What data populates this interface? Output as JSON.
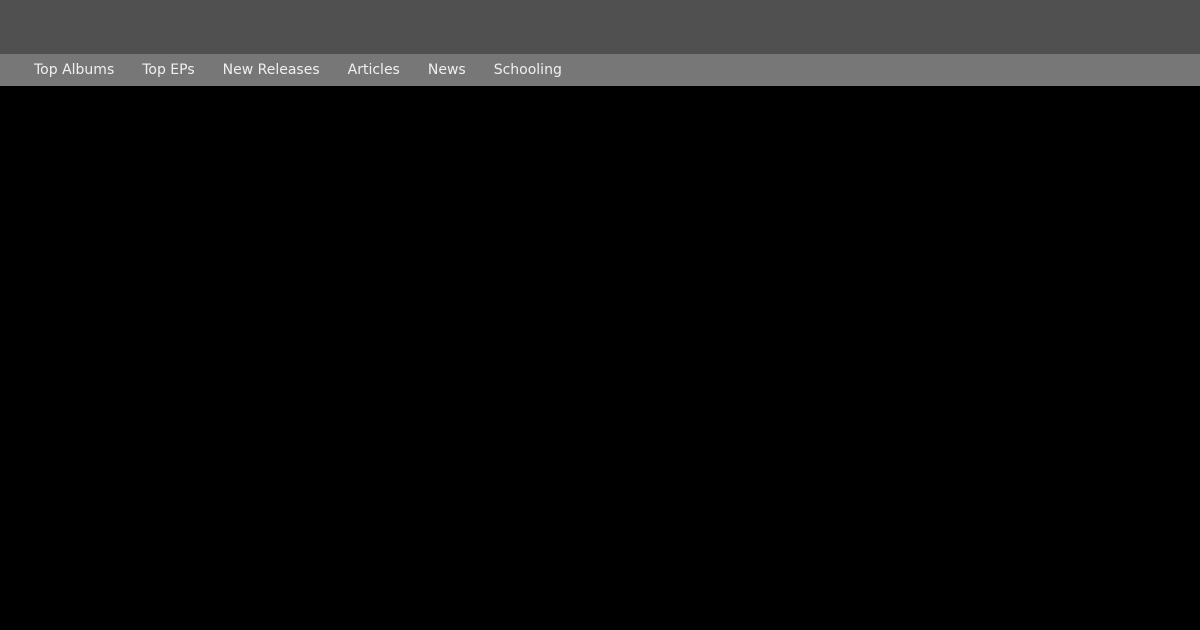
{
  "colors": {
    "header_bg": "#505050",
    "nav_bg": "#777777",
    "nav_text": "#f0f0f0",
    "content_bg": "#000000"
  },
  "nav": {
    "items": [
      {
        "label": "Top Albums"
      },
      {
        "label": "Top EPs"
      },
      {
        "label": "New Releases"
      },
      {
        "label": "Articles"
      },
      {
        "label": "News"
      },
      {
        "label": "Schooling"
      }
    ]
  }
}
